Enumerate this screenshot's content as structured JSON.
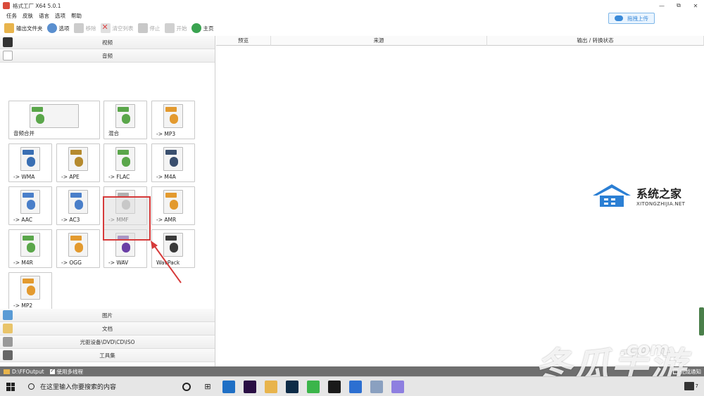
{
  "window": {
    "title": "格式工厂 X64 5.0.1",
    "controls": [
      "—",
      "⧉",
      "✕"
    ]
  },
  "menu": [
    "任务",
    "皮肤",
    "语言",
    "选项",
    "帮助"
  ],
  "upload_button": "拖拽上传",
  "toolbar": [
    {
      "label": "输出文件夹",
      "icon": "folder-icon",
      "enabled": true
    },
    {
      "label": "选项",
      "icon": "options-icon",
      "enabled": true
    },
    {
      "label": "移除",
      "icon": "remove-icon",
      "enabled": false
    },
    {
      "label": "清空列表",
      "icon": "clear-list-icon",
      "enabled": false
    },
    {
      "label": "停止",
      "icon": "stop-icon",
      "enabled": false
    },
    {
      "label": "开始",
      "icon": "start-icon",
      "enabled": false
    },
    {
      "label": "主页",
      "icon": "home-icon",
      "enabled": true
    }
  ],
  "sections": {
    "video": "视频",
    "audio": "音频",
    "image": "图片",
    "document": "文档",
    "disc": "光驱设备\\DVD\\CD\\ISO",
    "tools": "工具集"
  },
  "audio_tiles": [
    {
      "label": "音频合并",
      "badge": "",
      "color": "#5aa64a"
    },
    {
      "label": "混合",
      "badge": "",
      "color": "#5aa64a"
    },
    {
      "label": "-> MP3",
      "badge": "MP3",
      "color": "#e39a2f"
    },
    {
      "label": "-> WMA",
      "badge": "WMA",
      "color": "#3a6fb3"
    },
    {
      "label": "-> APE",
      "badge": "APE",
      "color": "#b58a2e"
    },
    {
      "label": "-> FLAC",
      "badge": "FLA",
      "color": "#5aa64a"
    },
    {
      "label": "-> M4A",
      "badge": "M4A",
      "color": "#3a4f6e"
    },
    {
      "label": "-> AAC",
      "badge": "AAC",
      "color": "#4a7fc9"
    },
    {
      "label": "-> AC3",
      "badge": "AAC",
      "color": "#4a7fc9"
    },
    {
      "label": "-> MMF",
      "badge": "MMF",
      "color": "#b0b0b0"
    },
    {
      "label": "-> AMR",
      "badge": "AMR",
      "color": "#e39a2f"
    },
    {
      "label": "-> M4R",
      "badge": "M4R",
      "color": "#5aa64a"
    },
    {
      "label": "-> OGG",
      "badge": "OGG",
      "color": "#e39a2f"
    },
    {
      "label": "-> WAV",
      "badge": "WAV",
      "color": "#6a3fa6"
    },
    {
      "label": "WavPack",
      "badge": "WV",
      "color": "#3a3a3a"
    },
    {
      "label": "-> MP2",
      "badge": "MP2",
      "color": "#e39a2f"
    }
  ],
  "list_columns": [
    "预览",
    "来源",
    "输出 / 转换状态"
  ],
  "watermark": {
    "cn": "系统之家",
    "en": "XITONGZHIJIA.NET"
  },
  "statusbar": {
    "output_path": "D:\\FFOutput",
    "multithread": "使用多线程",
    "finish_notify": "完成通知"
  },
  "brand_watermark": {
    "main": "冬瓜手游",
    "domain": ".com"
  },
  "taskbar": {
    "search_placeholder": "在这里输入你要搜索的内容",
    "apps": [
      {
        "name": "edge-icon",
        "color": "#1f6fc5"
      },
      {
        "name": "premiere-icon",
        "color": "#2a0f44"
      },
      {
        "name": "file-explorer-icon",
        "color": "#e8b44c"
      },
      {
        "name": "photoshop-icon",
        "color": "#0d2b47"
      },
      {
        "name": "wechat-icon",
        "color": "#3bb54a"
      },
      {
        "name": "qq-icon",
        "color": "#1a1a1a"
      },
      {
        "name": "tablet-icon",
        "color": "#2c6fd1"
      },
      {
        "name": "format-factory-icon",
        "color": "#8aa0c0"
      },
      {
        "name": "baidu-netdisk-icon",
        "color": "#8e7fe0"
      }
    ],
    "notification_count": "7"
  }
}
